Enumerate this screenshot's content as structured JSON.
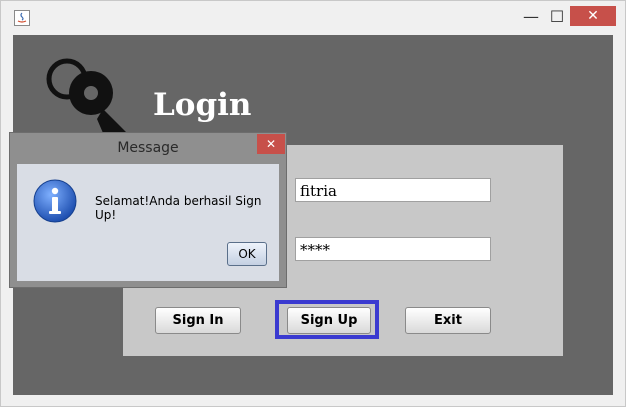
{
  "window": {
    "title": "",
    "minimize_glyph": "—",
    "maximize_glyph": "☐",
    "close_glyph": "✕"
  },
  "login": {
    "title": "Login",
    "username_value": "fitria",
    "password_value": "****",
    "buttons": {
      "sign_in": "Sign In",
      "sign_up": "Sign Up",
      "exit": "Exit"
    }
  },
  "dialog": {
    "title": "Message",
    "close_glyph": "✕",
    "message": "Selamat!Anda berhasil Sign Up!",
    "ok_label": "OK",
    "icon": "info-icon"
  },
  "colors": {
    "content_bg": "#666666",
    "panel_bg": "#c8c8c8",
    "focus_ring": "#3a3ad0",
    "close_red": "#c7504a"
  }
}
